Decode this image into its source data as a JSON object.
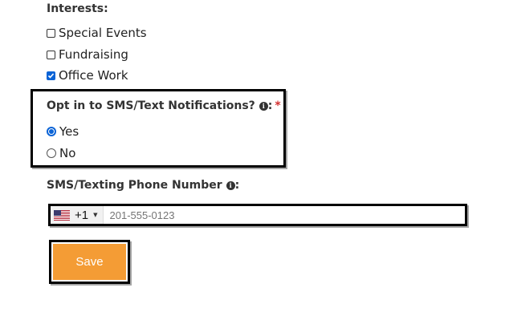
{
  "interests": {
    "label": "Interests:",
    "options": [
      {
        "label": "Special Events",
        "checked": false
      },
      {
        "label": "Fundraising",
        "checked": false
      },
      {
        "label": "Office Work",
        "checked": true
      }
    ]
  },
  "sms_opt_in": {
    "label": "Opt in to SMS/Text Notifications?",
    "colon": ":",
    "required_marker": "*",
    "options": [
      {
        "label": "Yes",
        "selected": true
      },
      {
        "label": "No",
        "selected": false
      }
    ]
  },
  "phone": {
    "label": "SMS/Texting Phone Number",
    "colon": ":",
    "country_dial_code": "+1",
    "country_flag": "us-flag-icon",
    "placeholder": "201-555-0123"
  },
  "save_button": {
    "label": "Save",
    "color": "#f49c35"
  }
}
